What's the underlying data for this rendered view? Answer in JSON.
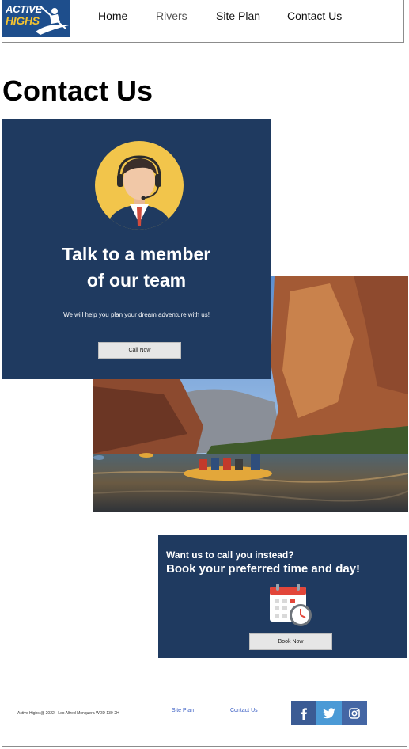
{
  "header": {
    "logo": {
      "line1": "ACTIVE",
      "line2": "HIGHS"
    },
    "nav": [
      {
        "label": "Home"
      },
      {
        "label": "Rivers"
      },
      {
        "label": "Site Plan"
      },
      {
        "label": "Contact Us"
      }
    ]
  },
  "page": {
    "title": "Contact Us"
  },
  "talk_card": {
    "title_line1": "Talk to a member",
    "title_line2": "of our team",
    "subtitle": "We will help you plan your dream adventure with us!",
    "button_label": "Call Now",
    "background": "#1f3a60",
    "avatar_bg": "#f2c54b"
  },
  "book_card": {
    "question": "Want us to call you instead?",
    "headline": "Book your preferred time and day!",
    "button_label": "Book Now"
  },
  "footer": {
    "copyright": "Active Highs @ 2022 - Leo Alfred Monquera WDD 130-2H",
    "links": [
      {
        "label": "Site Plan"
      },
      {
        "label": "Contact Us"
      }
    ],
    "social": [
      {
        "icon": "facebook-icon",
        "glyph": "f",
        "color": "#3b5b94"
      },
      {
        "icon": "twitter-icon",
        "glyph": "🐦",
        "color": "#4b9ad6"
      },
      {
        "icon": "instagram-icon",
        "glyph": "◙",
        "color": "#4466a4"
      }
    ]
  }
}
